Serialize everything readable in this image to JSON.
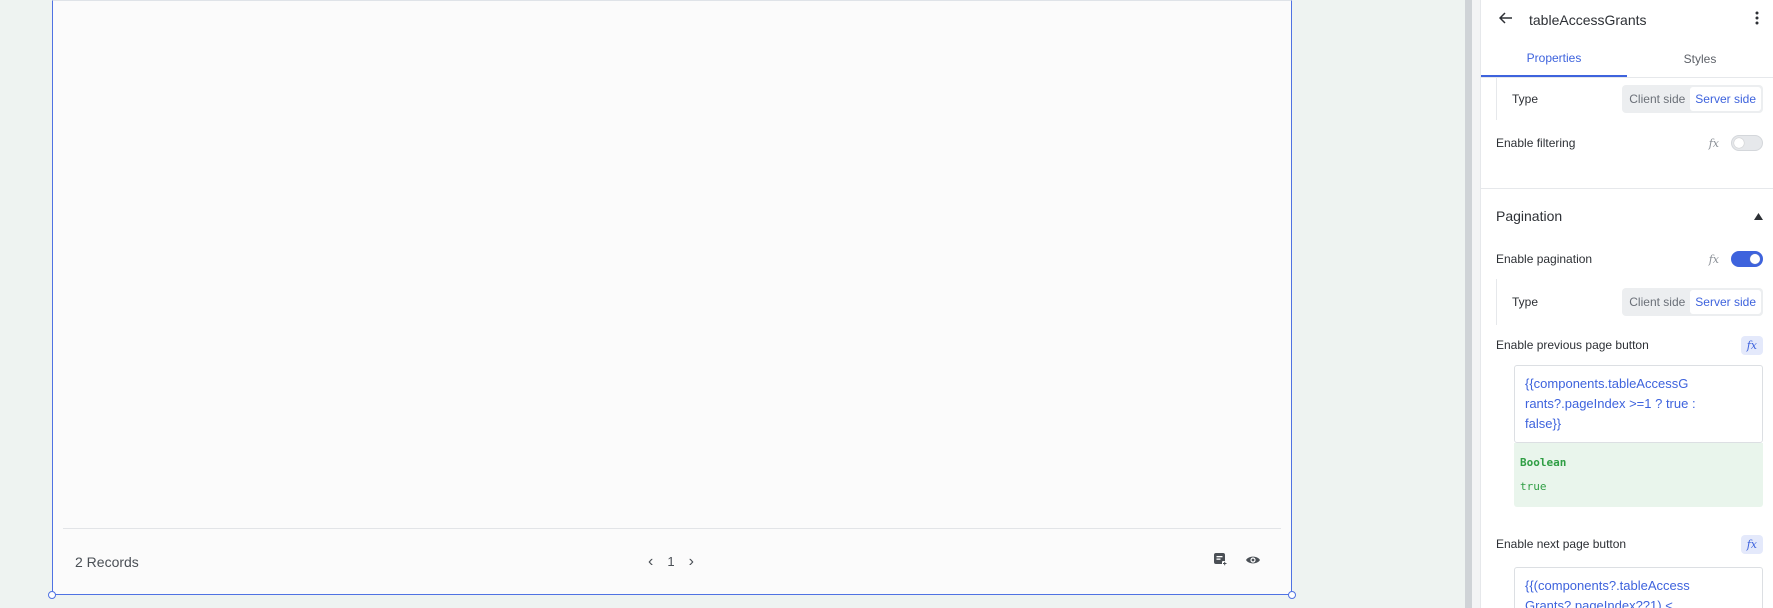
{
  "canvas": {
    "records_label": "2 Records",
    "current_page": "1",
    "prev_glyph": "‹",
    "next_glyph": "›"
  },
  "inspector": {
    "title": "tableAccessGrants",
    "tabs": [
      "Properties",
      "Styles"
    ],
    "filter_type": {
      "label": "Type",
      "options": [
        "Client side",
        "Server side"
      ],
      "selected": "Server side"
    },
    "enable_filtering": {
      "label": "Enable filtering",
      "fx": "fx",
      "enabled": false
    },
    "pagination": {
      "title": "Pagination",
      "enable_pagination": {
        "label": "Enable pagination",
        "fx": "fx",
        "enabled": true
      },
      "type": {
        "label": "Type",
        "options": [
          "Client side",
          "Server side"
        ],
        "selected": "Server side"
      },
      "prev_button": {
        "label": "Enable previous page button",
        "fx": "fx",
        "code_lines": [
          "{{components.tableAccessG",
          "rants?.pageIndex >=1 ? true :",
          "false}}"
        ],
        "preview_type": "Boolean",
        "preview_value": "true"
      },
      "next_button": {
        "label": "Enable next page button",
        "fx": "fx",
        "code_lines": [
          "{{(components?.tableAccess",
          "Grants?.pageIndex??1) <"
        ]
      }
    }
  },
  "colors": {
    "accent": "#3e63dd",
    "selection": "#4f72e3",
    "preview_bg": "#e9f5ec",
    "code_green": "#2f9e44"
  }
}
